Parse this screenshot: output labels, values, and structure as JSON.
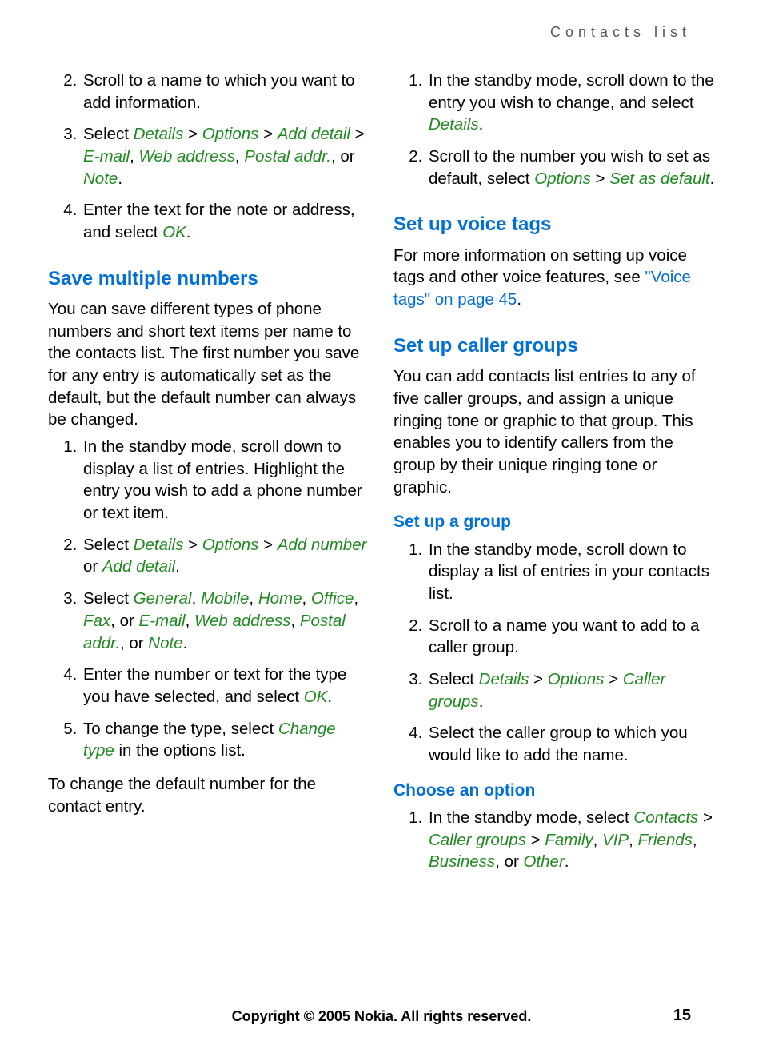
{
  "header": {
    "section": "Contacts list"
  },
  "left": {
    "list1": {
      "item2": "Scroll to a name to which you want to add information.",
      "item3": {
        "pre": "Select ",
        "d": "Details",
        "sep1": " > ",
        "o": "Options",
        "sep2": " > ",
        "ad": "Add detail",
        "sep3": " > ",
        "em": "E-mail",
        "c1": ", ",
        "wa": "Web address",
        "c2": ", ",
        "pa": "Postal addr.",
        "c3": ", or ",
        "note": "Note",
        "end": "."
      },
      "item4": {
        "pre": "Enter the text for the note or address, and select ",
        "ok": "OK",
        "end": "."
      }
    },
    "h_save": "Save multiple numbers",
    "p_save": "You can save different types of phone numbers and short text items per name to the contacts list. The first number you save for any entry is automatically set as the default, but the default number can always be changed.",
    "list2": {
      "item1": "In the standby mode, scroll down to display a list of entries. Highlight the entry you wish to add a phone number or text item.",
      "item2": {
        "pre": "Select ",
        "d": "Details",
        "sep1": " > ",
        "o": "Options",
        "sep2": " > ",
        "an": "Add number",
        "mid": " or ",
        "ad": "Add detail",
        "end": "."
      },
      "item3": {
        "pre": "Select ",
        "g": "General",
        "c1": ", ",
        "m": "Mobile",
        "c2": ", ",
        "h": "Home",
        "c3": ", ",
        "off": "Office",
        "c4": ", ",
        "f": "Fax",
        "c5": ", or ",
        "em": "E-mail",
        "c6": ", ",
        "wa": "Web address",
        "c7": ", ",
        "pa": "Postal addr.",
        "c8": ", or ",
        "note": "Note",
        "end": "."
      },
      "item4": {
        "pre": "Enter the number or text for the type you have selected, and select ",
        "ok": "OK",
        "end": "."
      },
      "item5": {
        "pre": "To change the type, select ",
        "ct": "Change type",
        "post": " in the options list."
      }
    },
    "p_after": "To change the default number for the contact entry."
  },
  "right": {
    "list1": {
      "item1": {
        "pre": "In the standby mode, scroll down to the entry you wish to change, and select ",
        "d": "Details",
        "end": "."
      },
      "item2": {
        "pre": "Scroll to the number you wish to set as default, select ",
        "o": "Options",
        "sep": " > ",
        "sd": "Set as default",
        "end": "."
      }
    },
    "h_voice": "Set up voice tags",
    "p_voice": {
      "pre": "For more information on setting up voice tags and other voice features, see ",
      "link": "\"Voice tags\" on page 45",
      "end": "."
    },
    "h_groups": "Set up caller groups",
    "p_groups": "You can add contacts list entries to any of five caller groups, and assign a unique ringing tone or graphic to that group. This enables you to identify callers from the group by their unique ringing tone or graphic.",
    "h_setup_group": "Set up a group",
    "list2": {
      "item1": "In the standby mode, scroll down to display a list of entries in your contacts list.",
      "item2": "Scroll to a name you want to add to a caller group.",
      "item3": {
        "pre": "Select ",
        "d": "Details",
        "sep1": " > ",
        "o": "Options",
        "sep2": " > ",
        "cg": "Caller groups",
        "end": "."
      },
      "item4": "Select the caller group to which you would like to add the name."
    },
    "h_choose": "Choose an option",
    "list3": {
      "item1": {
        "pre": "In the standby mode, select ",
        "c": "Contacts",
        "sep1": " > ",
        "cg": "Caller groups",
        "sep2": " > ",
        "fam": "Family",
        "c1": ", ",
        "vip": "VIP",
        "c2": ", ",
        "fr": "Friends",
        "c3": ", ",
        "bus": "Business",
        "c4": ", or ",
        "oth": "Other",
        "end": "."
      }
    }
  },
  "footer": {
    "copyright": "Copyright © 2005 Nokia. All rights reserved.",
    "page": "15"
  }
}
